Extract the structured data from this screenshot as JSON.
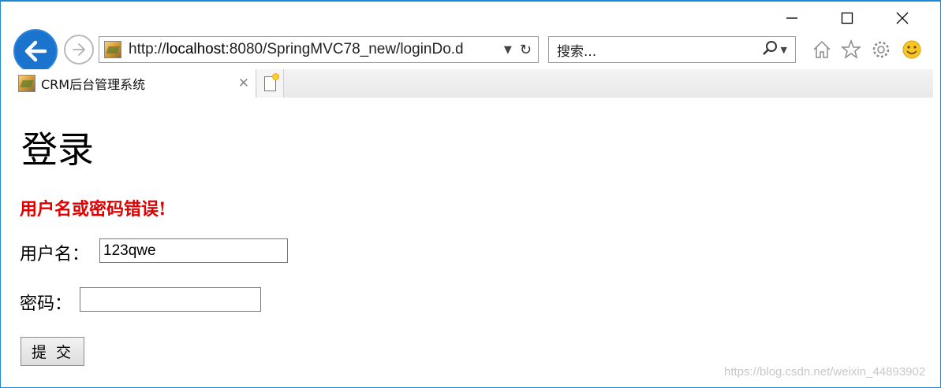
{
  "browser": {
    "url": "http://localhost:8080/SpringMVC78_new/loginDo.d",
    "url_host_bold": "localhost",
    "search_placeholder": "搜索...",
    "tab_title": "CRM后台管理系统"
  },
  "page": {
    "title": "登录",
    "error_message": "用户名或密码错误!",
    "username_label": "用户名：",
    "username_value": "123qwe",
    "password_label": "密码：",
    "password_value": "",
    "submit_label": "提 交"
  },
  "watermark": "https://blog.csdn.net/weixin_44893902",
  "colors": {
    "accent": "#1a73cc",
    "error": "#e00000"
  }
}
